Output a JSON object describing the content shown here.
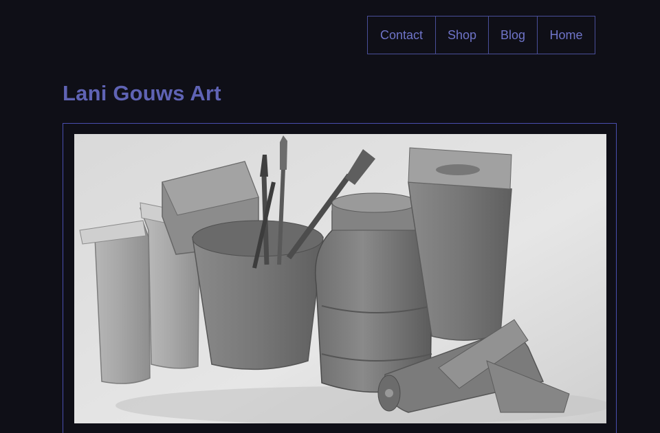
{
  "nav": {
    "items": [
      {
        "label": "Contact"
      },
      {
        "label": "Shop"
      },
      {
        "label": "Blog"
      },
      {
        "label": "Home"
      }
    ]
  },
  "site": {
    "title": "Lani Gouws Art"
  },
  "artwork": {
    "subject": "still-life-painting-icon"
  },
  "colors": {
    "background": "#0f0f17",
    "accent": "#6f74c9",
    "border": "#4a4f9a"
  }
}
